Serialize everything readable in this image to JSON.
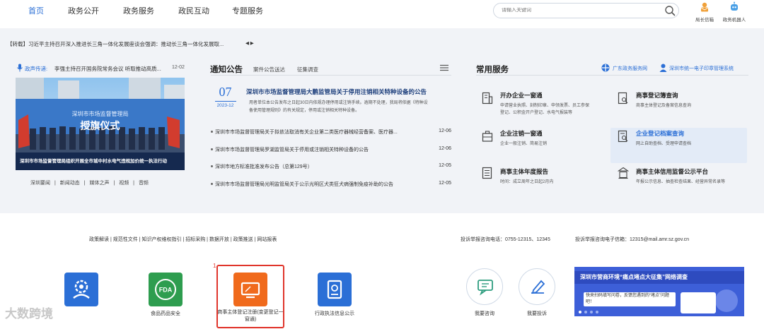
{
  "nav": {
    "items": [
      "首页",
      "政务公开",
      "政务服务",
      "政民互动",
      "专题服务"
    ],
    "active_index": 0,
    "search_placeholder": "请输入关键词",
    "tools": [
      "局长信箱",
      "政务机器人"
    ]
  },
  "ticker": {
    "text": "【转载】习近平主持召开深入推进长三角一体化发展座谈会强调：推动长三角一体化发展取...",
    "arrows": "◀ ▶"
  },
  "left": {
    "head_label": "政声传递:",
    "head_text": "李强主持召开国务院常务会议 听取推动高质...",
    "head_date": "12-02",
    "photo_banner_top": "深圳市市场监督管理局",
    "photo_banner_main": "授旗仪式",
    "photo_caption": "深圳市市场监督管理局组织开展全市城中村水电气违规加价统一执法行动",
    "sub_links": [
      "深圳要闻",
      "|",
      "新闻动态",
      "|",
      "媒体之声",
      "|",
      "视频",
      "|",
      "音频"
    ]
  },
  "notice": {
    "title": "通知公告",
    "tabs": [
      "案件公告送达",
      "征集调查"
    ],
    "menu_icon": "hamburger-icon",
    "featured": {
      "day": "07",
      "year_month": "2023-12",
      "headline": "深圳市市场监督管理局大鹏监管局关于停用注销相关特种设备的公告",
      "snippet": "用者单位本公告发布之日起30日内依规办理停用或注销手续。逾期不处理，我局将依据《特种设备使用管理规则》的有关规定，停用或注销相关特种设备。"
    },
    "rows": [
      {
        "text": "深圳市市场监督管理局关于拟依法取消有关企业第二类医疗器械经营备案、医疗器...",
        "date": "12-06"
      },
      {
        "text": "深圳市市场监督管理局罗湖监管局关于停用或注销相关特种设备的公告",
        "date": "12-06"
      },
      {
        "text": "深圳市地方标准批准发布公告（总第129号）",
        "date": "12-05"
      },
      {
        "text": "深圳市市场监督管理局光明监管局关于公示光明区犬类狂犬病强制免疫补助的公告",
        "date": "12-05"
      }
    ]
  },
  "services": {
    "title": "常用服务",
    "links": [
      "广东政务服务网",
      "深圳市统一电子印章管理系统"
    ],
    "items": [
      {
        "title": "开办企业一窗通",
        "desc": "申请营业执照、刻制印章、申领发票、员工参保登记、公积金开户登记、水电气报装等",
        "icon": "building-icon"
      },
      {
        "title": "商事登记簿查询",
        "desc": "商事主体登记及备案信息查询",
        "icon": "search-document-icon"
      },
      {
        "title": "企业注销一窗通",
        "desc": "企业一般注销、简易注销",
        "icon": "briefcase-icon"
      },
      {
        "title": "企业登记档案查询",
        "desc": "网上自助查档、受理申请查档",
        "icon": "document-search-icon"
      },
      {
        "title": "商事主体年度报告",
        "desc": "时间：成立周年之日起2月内",
        "icon": "report-icon"
      },
      {
        "title": "商事主体信用监督公示平台",
        "desc": "年报公示信息、抽查检查结果、经营异常名录等",
        "icon": "credit-platform-icon"
      }
    ]
  },
  "footer": {
    "links": [
      "政策解读",
      "|",
      "规范性文件",
      "|",
      "知识产权维权指引",
      "|",
      "招标采购",
      "|",
      "数据开放",
      "|",
      "政策推送",
      "|",
      "网站报表"
    ],
    "phone": "投诉举报咨询电话：0755-12315、12345",
    "email": "投诉举报咨询电子信箱：12315@mail.amr.sz.gov.cn"
  },
  "apps": [
    {
      "label": "",
      "icon": "gear-people-icon",
      "color": "#2b6fd6"
    },
    {
      "label": "食品药品安全",
      "icon": "fda-icon",
      "color": "#2e9d4f"
    },
    {
      "label": "商事主体登记注册(变更登记一窗通)",
      "icon": "monitor-icon",
      "color": "#f06a1c"
    },
    {
      "label": "行政执法信息公示",
      "icon": "law-document-icon",
      "color": "#2b6fd6"
    }
  ],
  "interact": [
    {
      "label": "我要咨询",
      "icon": "chat-icon"
    },
    {
      "label": "我要投诉",
      "icon": "complaint-icon"
    }
  ],
  "annotation_number": "1",
  "banner": {
    "title": "深圳市营商环境“痛点堵点大征集”网络调查",
    "body": "快来扫码填写问卷，反馈您遇到的“堵点”问题吧！"
  },
  "watermark": "大数跨境",
  "colors": {
    "accent": "#2b6fd6",
    "orange": "#f06a1c",
    "green": "#2e9d4f",
    "annotation": "#e0352b"
  }
}
